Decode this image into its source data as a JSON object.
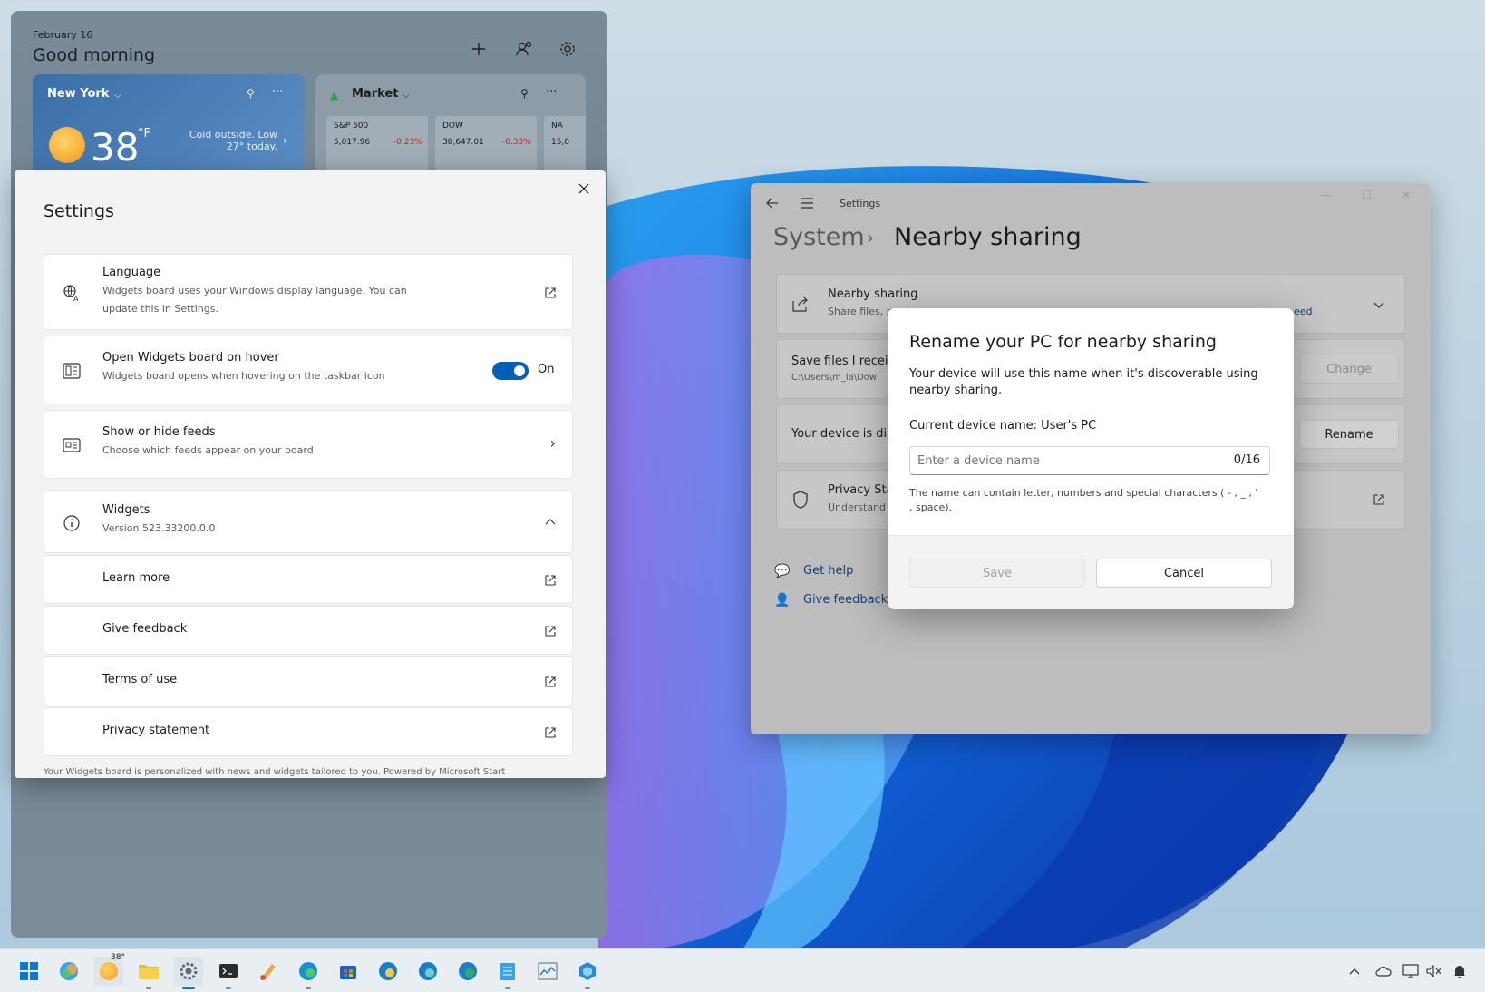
{
  "widgets_board": {
    "date": "February 16",
    "greeting": "Good morning",
    "weather": {
      "city": "New York",
      "temp": "38",
      "unit": "°F",
      "summary_line1": "Cold outside. Low",
      "summary_line2": "27° today."
    },
    "market": {
      "title": "Market",
      "tickers": [
        {
          "name": "S&P 500",
          "value": "5,017.96",
          "change": "-0.23%"
        },
        {
          "name": "DOW",
          "value": "38,647.01",
          "change": "-0.33%"
        },
        {
          "name": "NA",
          "value": "15,0",
          "change": ""
        }
      ]
    }
  },
  "widgets_settings": {
    "title": "Settings",
    "language": {
      "title": "Language",
      "desc_line1": "Widgets board uses your Windows display language. You can",
      "desc_line2": "update this in Settings."
    },
    "hover": {
      "title": "Open Widgets board on hover",
      "desc": "Widgets board opens when hovering on the taskbar icon",
      "toggle_state": "On"
    },
    "feeds": {
      "title": "Show or hide feeds",
      "desc": "Choose which feeds appear on your board"
    },
    "about": {
      "title": "Widgets",
      "version": "Version 523.33200.0.0"
    },
    "links": [
      "Learn more",
      "Give feedback",
      "Terms of use",
      "Privacy statement"
    ],
    "footer": "Your Widgets board is personalized with news and widgets tailored to you. Powered by Microsoft Start"
  },
  "system_settings": {
    "window_title": "Settings",
    "breadcrumb_parent": "System",
    "breadcrumb_current": "Nearby sharing",
    "nearby_title": "Nearby sharing",
    "nearby_desc": "Share files, p",
    "nearby_link_fragment": "eed",
    "save_files_title": "Save files I receive",
    "save_files_path": "C:\\Users\\m_la\\Dow",
    "change_button": "Change",
    "device_text": "Your device is disc",
    "rename_button": "Rename",
    "privacy_title": "Privacy Sta",
    "privacy_desc": "Understand",
    "get_help": "Get help",
    "give_feedback": "Give feedback"
  },
  "rename_dialog": {
    "title": "Rename your PC for nearby sharing",
    "desc": "Your device will use this name when it's discoverable using nearby sharing.",
    "current_name_label": "Current device name: User's PC",
    "input_placeholder": "Enter a device name",
    "char_count": "0/16",
    "hint": "The name can contain letter, numbers and special characters ( - , _ , ' , space).",
    "save_label": "Save",
    "cancel_label": "Cancel"
  },
  "taskbar": {
    "weather_temp": "38°",
    "icons": [
      "start-icon",
      "copilot-icon",
      "weather-icon",
      "file-explorer-icon",
      "settings-icon",
      "terminal-icon",
      "paint-icon",
      "edge-icon",
      "store-icon",
      "edge-canary-icon",
      "edge-beta-icon",
      "edge-dev-icon",
      "notepad-icon",
      "task-manager-icon",
      "dev-home-icon"
    ],
    "tray_icons": [
      "chevron-up-icon",
      "onedrive-icon",
      "network-icon",
      "volume-muted-icon",
      "notification-icon"
    ]
  },
  "colors": {
    "accent": "#0067c0",
    "toggle_on": "#005fb8",
    "negative": "#c42b1c"
  }
}
